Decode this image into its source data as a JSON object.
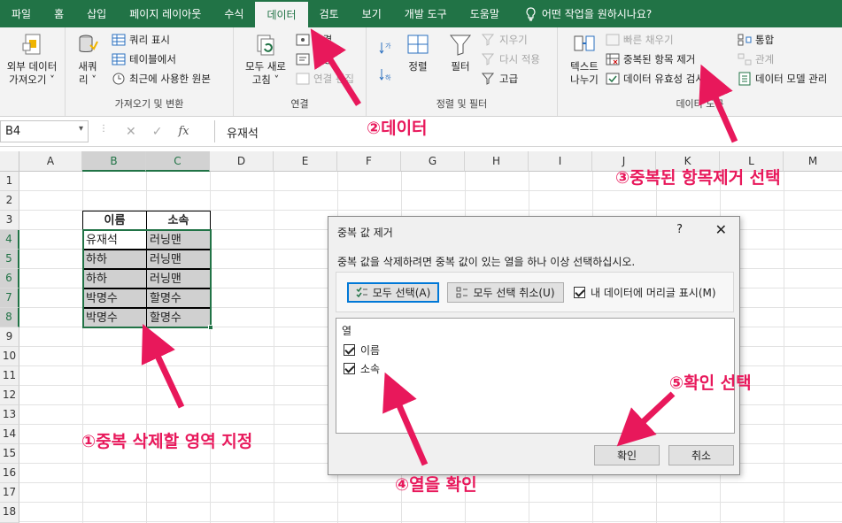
{
  "ribbon_tabs": [
    "파일",
    "홈",
    "삽입",
    "페이지 레이아웃",
    "수식",
    "데이터",
    "검토",
    "보기",
    "개발 도구",
    "도움말"
  ],
  "tell_me": "어떤 작업을 원하시나요?",
  "groups": {
    "external": {
      "label_line1": "외부 데이터",
      "label_line2": "가져오기 ˅"
    },
    "query": {
      "new_query_1": "새쿼",
      "new_query_2": "리 ˅",
      "show_queries": "쿼리 표시",
      "from_table": "테이블에서",
      "recent_sources": "최근에 사용한 원본",
      "label": "가져오기 및 변환"
    },
    "connections": {
      "refresh_1": "모두 새로",
      "refresh_2": "고침 ˅",
      "connections": "연결",
      "properties": "속성",
      "edit_links": "연결 편집",
      "label": "연결"
    },
    "sort": {
      "sort": "정렬",
      "filter": "필터",
      "clear": "지우기",
      "reapply": "다시 적용",
      "advanced": "고급",
      "label": "정렬 및 필터"
    },
    "tools": {
      "text_to_cols_1": "텍스트",
      "text_to_cols_2": "나누기",
      "flash_fill": "빠른 채우기",
      "remove_dup": "중복된 항목 제거",
      "validation": "데이터 유효성 검사 ˅",
      "consolidate": "통합",
      "relationships": "관계",
      "data_model": "데이터 모델 관리",
      "label": "데이터 도구"
    }
  },
  "formula_bar": {
    "name_box": "B4",
    "cancel": "✕",
    "enter": "✓",
    "fx": "fx",
    "value": "유재석"
  },
  "columns": [
    "A",
    "B",
    "C",
    "D",
    "E",
    "F",
    "G",
    "H",
    "I",
    "J",
    "K",
    "L",
    "M"
  ],
  "rows": [
    "1",
    "2",
    "3",
    "4",
    "5",
    "6",
    "7",
    "8",
    "9",
    "10",
    "11",
    "12",
    "13",
    "14",
    "15",
    "16",
    "17",
    "18"
  ],
  "table": {
    "headers": [
      "이름",
      "소속"
    ],
    "rows": [
      [
        "유재석",
        "러닝맨"
      ],
      [
        "하하",
        "러닝맨"
      ],
      [
        "하하",
        "러닝맨"
      ],
      [
        "박명수",
        "할명수"
      ],
      [
        "박명수",
        "할명수"
      ]
    ]
  },
  "dialog": {
    "title": "중복 값 제거",
    "help": "?",
    "close": "✕",
    "description": "중복 값을 삭제하려면 중복 값이 있는 열을 하나 이상 선택하십시오.",
    "select_all": "모두 선택(A)",
    "unselect_all": "모두 선택 취소(U)",
    "has_headers": "내 데이터에 머리글 표시(M)",
    "list_header": "열",
    "columns": [
      "이름",
      "소속"
    ],
    "ok": "확인",
    "cancel": "취소"
  },
  "annotations": {
    "step1": "①중복 삭제할 영역 지정",
    "step2": "②데이터",
    "step3": "③중복된 항목제거 선택",
    "step4": "④열을 확인",
    "step5": "⑤확인 선택"
  },
  "colors": {
    "excel_green": "#217346",
    "annotation_pink": "#e8185b",
    "selected_fill": "#d0d0d0"
  }
}
